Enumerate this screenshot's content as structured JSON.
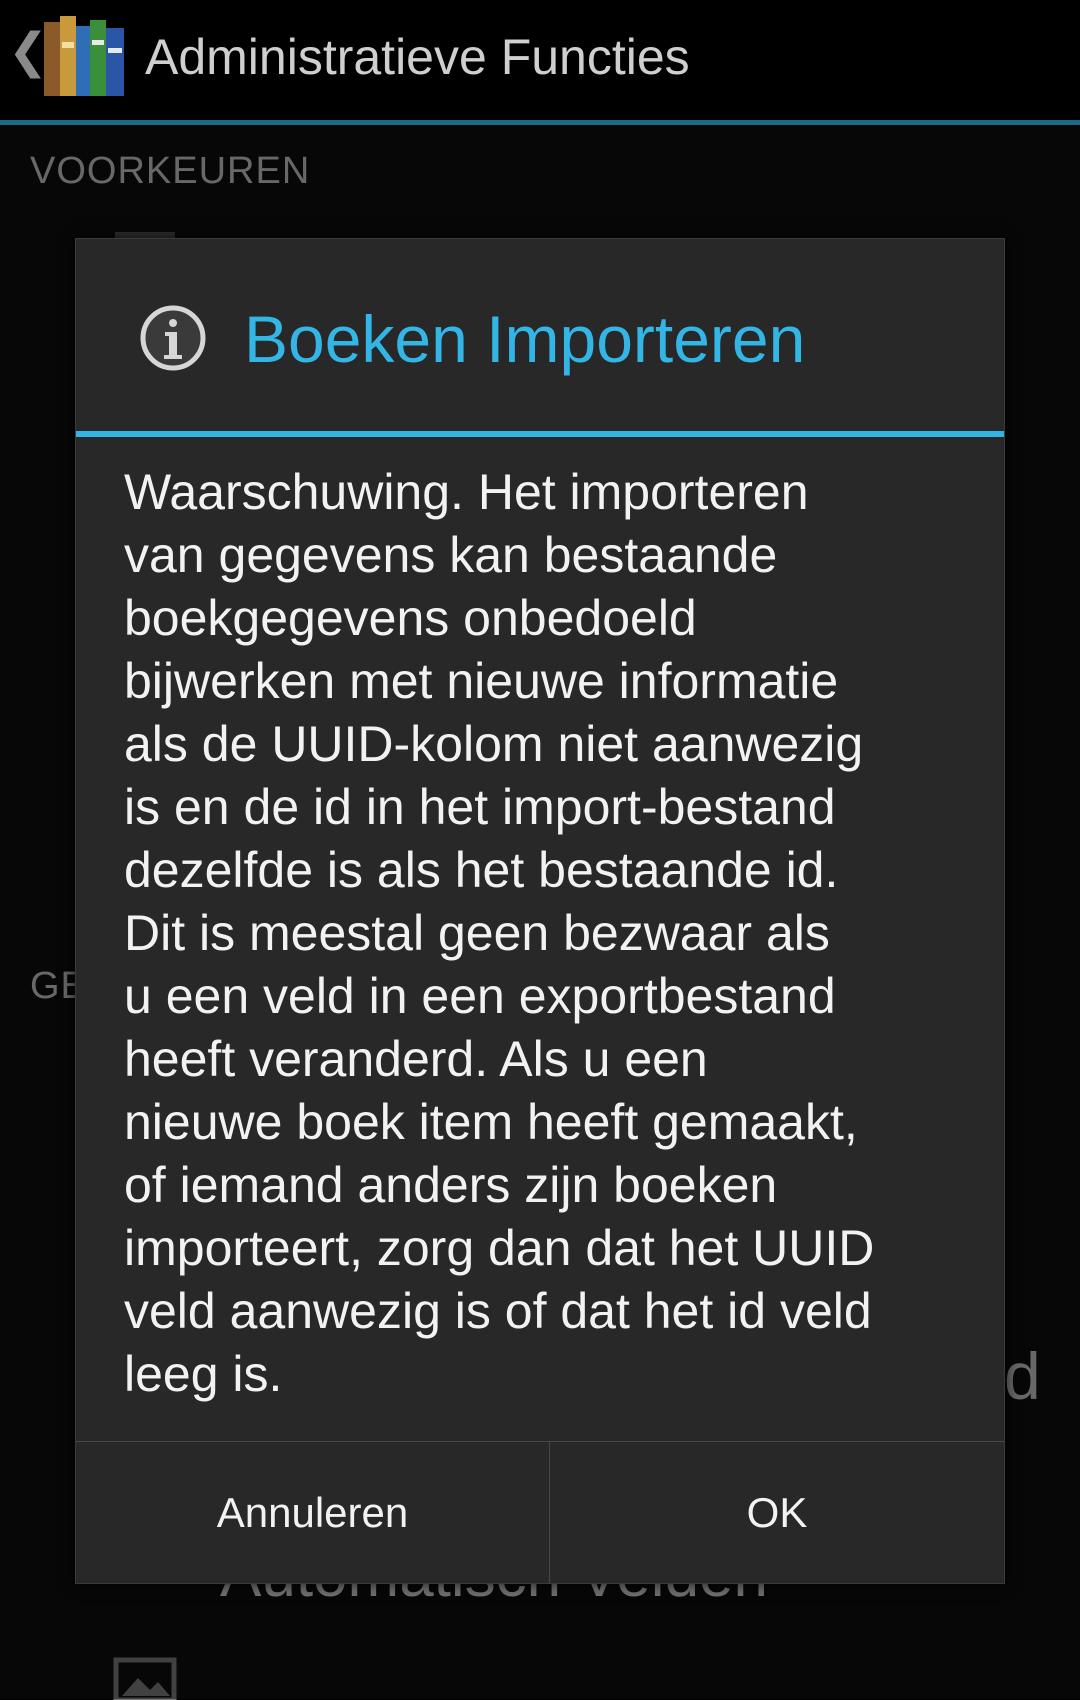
{
  "actionbar": {
    "title": "Administratieve Functies",
    "up_icon": "chevron-left-icon",
    "app_icon": "books-icon"
  },
  "background": {
    "category_1": "VOORKEUREN",
    "category_2_partial": "GE",
    "item_partial_1": "bestand",
    "item_partial_2": "Automatisch Velden",
    "right_fragment": "d"
  },
  "dialog": {
    "icon": "info-icon",
    "title": "Boeken Importeren",
    "message_lines": [
      "Waarschuwing. Het importeren",
      "van gegevens kan bestaande",
      "boekgegevens onbedoeld",
      "bijwerken met nieuwe informatie",
      "als de UUID-kolom niet aanwezig",
      "is en de id in het import-bestand",
      "dezelfde is als het bestaande id.",
      "Dit is meestal geen bezwaar als",
      "u een veld in een exportbestand",
      "heeft veranderd. Als u een",
      "nieuwe boek item heeft gemaakt,",
      "of iemand anders zijn boeken",
      "importeert, zorg dan dat het UUID",
      "veld aanwezig is of dat het id veld",
      "leeg is."
    ],
    "cancel_label": "Annuleren",
    "ok_label": "OK"
  },
  "colors": {
    "accent": "#33b5e5",
    "dialog_bg": "#282828",
    "actionbar_line": "#1c6a86"
  }
}
